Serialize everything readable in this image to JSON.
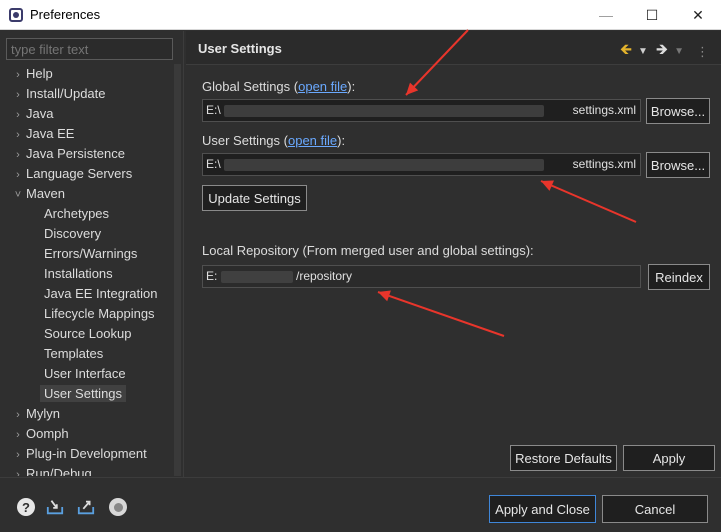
{
  "window": {
    "title": "Preferences",
    "controls": {
      "minimize": "—",
      "maximize": "☐",
      "close": "✕"
    }
  },
  "sidebar": {
    "filter_placeholder": "type filter text",
    "items": [
      {
        "label": "Help",
        "level": 0,
        "expanded": false
      },
      {
        "label": "Install/Update",
        "level": 0,
        "expanded": false
      },
      {
        "label": "Java",
        "level": 0,
        "expanded": false
      },
      {
        "label": "Java EE",
        "level": 0,
        "expanded": false
      },
      {
        "label": "Java Persistence",
        "level": 0,
        "expanded": false
      },
      {
        "label": "Language Servers",
        "level": 0,
        "expanded": false
      },
      {
        "label": "Maven",
        "level": 0,
        "expanded": true
      },
      {
        "label": "Archetypes",
        "level": 1
      },
      {
        "label": "Discovery",
        "level": 1
      },
      {
        "label": "Errors/Warnings",
        "level": 1
      },
      {
        "label": "Installations",
        "level": 1
      },
      {
        "label": "Java EE Integration",
        "level": 1
      },
      {
        "label": "Lifecycle Mappings",
        "level": 1
      },
      {
        "label": "Source Lookup",
        "level": 1
      },
      {
        "label": "Templates",
        "level": 1
      },
      {
        "label": "User Interface",
        "level": 1
      },
      {
        "label": "User Settings",
        "level": 1,
        "selected": true
      },
      {
        "label": "Mylyn",
        "level": 0,
        "expanded": false
      },
      {
        "label": "Oomph",
        "level": 0,
        "expanded": false
      },
      {
        "label": "Plug-in Development",
        "level": 0,
        "expanded": false
      },
      {
        "label": "Run/Debug",
        "level": 0,
        "expanded": false
      }
    ]
  },
  "page": {
    "title": "User Settings",
    "global_label": "Global Settings (",
    "global_link": "open file",
    "global_label_end": "):",
    "global_value_start": "E:\\",
    "global_value_end": "settings.xml",
    "user_label": "User Settings (",
    "user_link": "open file",
    "user_label_end": "):",
    "user_value_start": "E:\\",
    "user_value_end": "settings.xml",
    "browse_label": "Browse...",
    "update_settings_label": "Update Settings",
    "local_repo_label": "Local Repository (From merged user and global settings):",
    "local_repo_value_start": "E:",
    "local_repo_value_end": "/repository",
    "reindex_label": "Reindex",
    "restore_defaults_label": "Restore Defaults",
    "apply_label": "Apply"
  },
  "footer": {
    "apply_close_label": "Apply and Close",
    "cancel_label": "Cancel",
    "icons": [
      "help-icon",
      "import-icon",
      "export-icon",
      "record-icon"
    ]
  },
  "annotation_color": "#e8352b"
}
